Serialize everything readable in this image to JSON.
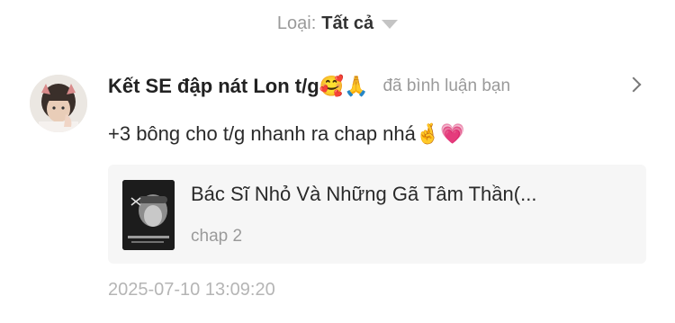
{
  "filter": {
    "label": "Loại:",
    "value": "Tất cả",
    "caret_icon": "caret-down-icon"
  },
  "notification": {
    "avatar_icon": "user-avatar",
    "username": "Kết SE đập nát Lon t/g🥰🙏",
    "action": "đã bình luận bạn",
    "chevron_icon": "chevron-right-icon",
    "comment": "+3 bông cho t/g nhanh ra chap nhá🤞💗",
    "story": {
      "cover_icon": "story-cover-thumbnail",
      "title": "Bác Sĩ Nhỏ Và Những Gã Tâm Thần(...",
      "chapter": "chap 2"
    },
    "timestamp": "2025-07-10 13:09:20"
  }
}
